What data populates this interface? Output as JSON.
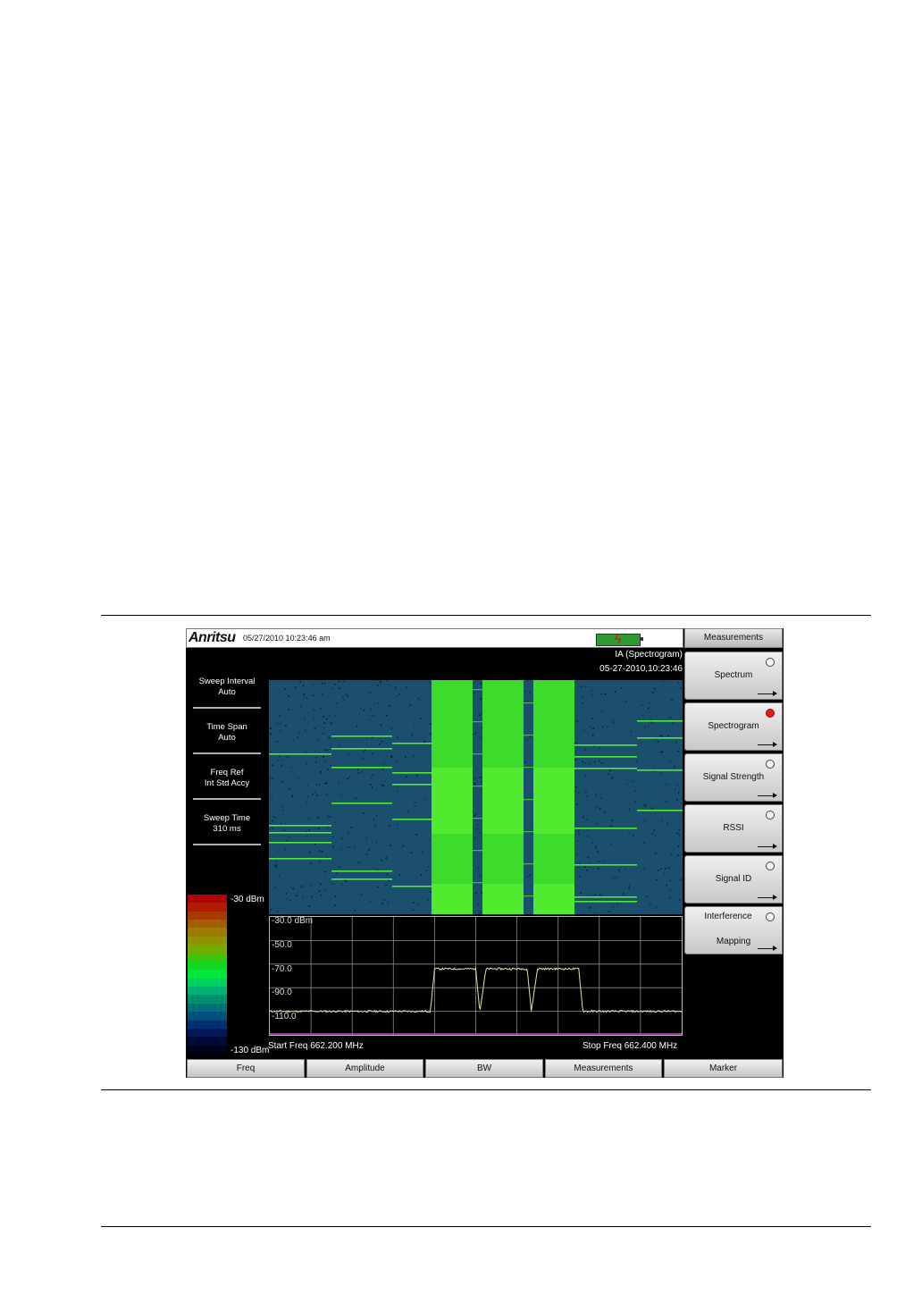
{
  "titlebar": {
    "logo": "Anritsu",
    "datetime": "05/27/2010 10:23:46 am"
  },
  "mode": {
    "name": "IA (Spectrogram)",
    "timestamp": "05-27-2010,10:23:46"
  },
  "parameters": [
    {
      "name": "Sweep Interval",
      "value": "Auto"
    },
    {
      "name": "Time Span",
      "value": "Auto"
    },
    {
      "name": "Freq Ref",
      "value": "Int Std Accy"
    },
    {
      "name": "Sweep Time",
      "value": "310 ms"
    }
  ],
  "colorbar": {
    "top_label": "-30 dBm",
    "bottom_label": "-130 dBm",
    "colors": [
      "#b30000",
      "#b01a00",
      "#a83a00",
      "#a45c00",
      "#9a7a00",
      "#8f9300",
      "#6fae00",
      "#3ec40a",
      "#10d91f",
      "#00e840",
      "#00d060",
      "#00b070",
      "#00906e",
      "#00707a",
      "#004f7c",
      "#003070",
      "#001858",
      "#000a38",
      "#02051a"
    ]
  },
  "trace": {
    "ref_levels": [
      "-30.0 dBm",
      "-50.0",
      "-70.0",
      "-90.0",
      "-110.0"
    ],
    "start_freq": "Start Freq 662.200 MHz",
    "stop_freq": "Stop Freq 662.400 MHz",
    "trace_color": "#e8e59a",
    "grid_color": "#8a8a8a",
    "baseline_color": "#d040d0"
  },
  "chart_data": {
    "type": "line",
    "x": [
      662.2,
      662.24,
      662.278,
      662.28,
      662.3,
      662.302,
      662.305,
      662.325,
      662.327,
      662.33,
      662.35,
      662.352,
      662.355,
      662.375,
      662.377,
      662.4
    ],
    "series": [
      {
        "values": [
          -110,
          -110,
          -110,
          -74,
          -74,
          -110,
          -74,
          -74,
          -110,
          -74,
          -74,
          -110,
          -110,
          -110,
          -110,
          -110
        ]
      }
    ],
    "ylim": [
      -130,
      -30
    ],
    "xlim": [
      662.2,
      662.4
    ]
  },
  "softkeys": {
    "title": "Measurements",
    "items": [
      {
        "label": "Spectrum",
        "selected": false
      },
      {
        "label": "Spectrogram",
        "selected": true
      },
      {
        "label": "Signal Strength",
        "selected": false
      },
      {
        "label": "RSSI",
        "selected": false
      },
      {
        "label": "Signal ID",
        "selected": false
      },
      {
        "label": "Interference",
        "label2": "Mapping",
        "selected": false
      }
    ]
  },
  "bottom_menu": [
    "Freq",
    "Amplitude",
    "BW",
    "Measurements",
    "Marker"
  ],
  "colors": {
    "spectrogram_background": "#1a4f6e",
    "signal_green": "#3ddc2a",
    "signal_green_bright": "#52ea2e"
  }
}
